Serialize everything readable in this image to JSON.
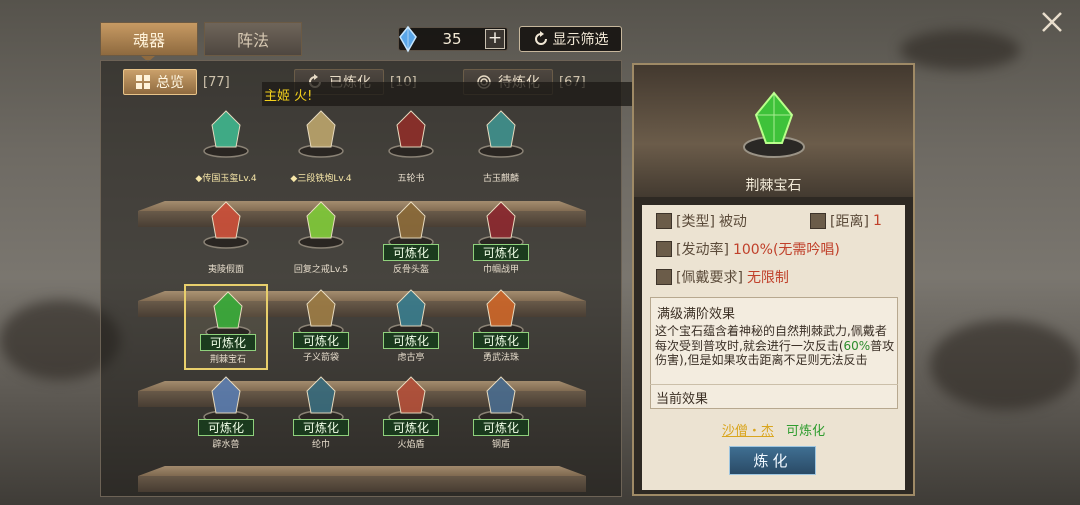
{
  "top_tabs": [
    {
      "label": "魂器",
      "active": true
    },
    {
      "label": "阵法",
      "active": false
    }
  ],
  "currency": {
    "value": "35",
    "icon": "blue-gem-icon",
    "plus": "+"
  },
  "filter_button": {
    "label": "显示筛选",
    "icon": "refresh-icon"
  },
  "close_icon": "close-icon",
  "sub_tabs": [
    {
      "label": "总览",
      "count": "[77]",
      "active": true
    },
    {
      "label": "已炼化",
      "count": "[10]",
      "active": false
    },
    {
      "label": "待炼化",
      "count": "[67]",
      "active": false
    }
  ],
  "notice": "主姬 火!",
  "items": [
    {
      "label": "◆传国玉玺Lv.4",
      "badge": "",
      "gold": true,
      "color": "#3fb08a"
    },
    {
      "label": "◆三段铁炮Lv.4",
      "badge": "",
      "gold": true,
      "color": "#b7a16a"
    },
    {
      "label": "五轮书",
      "badge": "",
      "gold": false,
      "color": "#8a2f2a"
    },
    {
      "label": "古玉麒麟",
      "badge": "",
      "gold": false,
      "color": "#3f8e8a"
    },
    {
      "label": "夷陵假面",
      "badge": "",
      "gold": false,
      "color": "#c8503a"
    },
    {
      "label": "回复之戒Lv.5",
      "badge": "",
      "gold": false,
      "color": "#7fc63a"
    },
    {
      "label": "反骨头盔",
      "badge": "可炼化",
      "gold": false,
      "color": "#8a6a3a"
    },
    {
      "label": "巾帼战甲",
      "badge": "可炼化",
      "gold": false,
      "color": "#8a2a30"
    },
    {
      "label": "荆棘宝石",
      "badge": "可炼化",
      "gold": false,
      "color": "#3aa83a",
      "selected": true
    },
    {
      "label": "子义箭袋",
      "badge": "可炼化",
      "gold": false,
      "color": "#9a7a45"
    },
    {
      "label": "虑古亭",
      "badge": "可炼化",
      "gold": false,
      "color": "#3a7a8a"
    },
    {
      "label": "勇武法珠",
      "badge": "可炼化",
      "gold": false,
      "color": "#c8652a"
    },
    {
      "label": "辟水兽",
      "badge": "可炼化",
      "gold": false,
      "color": "#5a7aaa"
    },
    {
      "label": "纶巾",
      "badge": "可炼化",
      "gold": false,
      "color": "#3a6a7a"
    },
    {
      "label": "火焰盾",
      "badge": "可炼化",
      "gold": false,
      "color": "#b0503a"
    },
    {
      "label": "钢盾",
      "badge": "可炼化",
      "gold": false,
      "color": "#4a6a8a"
    }
  ],
  "detail": {
    "name": "荆棘宝石",
    "type_key": "[类型]",
    "type_val": "被动",
    "range_key": "[距离]",
    "range_val": "1",
    "rate_key": "[发动率]",
    "rate_val": "100%(无需吟唱)",
    "req_key": "[佩戴要求]",
    "req_val": "无限制",
    "max_title": "满级满阶效果",
    "desc_a": "这个宝石蕴含着神秘的自然荆棘武力,佩戴者每次受到普攻时,就会进行一次反击(",
    "desc_pct": "60%",
    "desc_b": "普攻伤害),但是如果攻击距离不足则无法反击",
    "current_title": "当前效果",
    "who": "沙僧・杰",
    "status": "可炼化",
    "refine_label": "炼化"
  }
}
